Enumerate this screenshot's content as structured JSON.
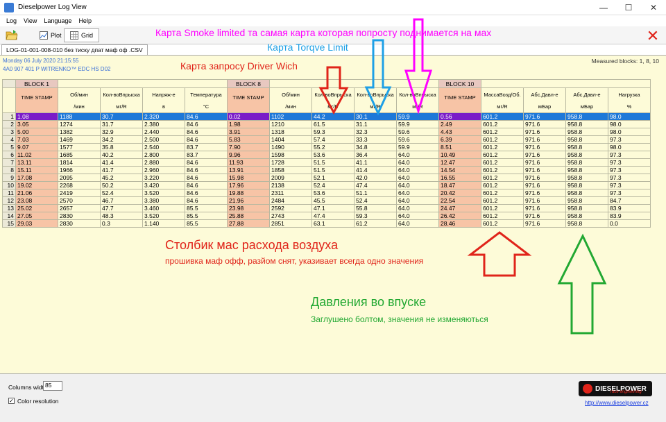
{
  "window": {
    "title": "Dieselpower Log View",
    "minimize": "—",
    "maximize": "☐",
    "close": "✕"
  },
  "menu": [
    "Log",
    "View",
    "Language",
    "Help"
  ],
  "toolbar": {
    "plot_label": "Plot",
    "grid_label": "Grid",
    "close_glyph": "✕"
  },
  "file_tab": "LOG-01-001-008-010  без тиску дпат маф оф .CSV",
  "info": {
    "line1": "Monday 06 July 2020 21:15:55",
    "line2": "4A0 907 401 P  WITRENKO™   EDC  HS D02",
    "measured": "Measured blocks: 1, 8, 10"
  },
  "annotations": {
    "smoke": "Карта Smoke limited та самая карта которая попросту поднимается на мах",
    "torque": "Карта Torqve Limit",
    "driver": "Карта запросу Driver Wich",
    "maf_title": "Столбик мас расхода воздуха",
    "maf_sub": "прошивка маф офф, разйом снят, указивает всегда одно значения",
    "boost_title": "Давления во впуске",
    "boost_sub": "Заглушено болтом, значения не изменяються"
  },
  "colors": {
    "smoke": "#ff00ff",
    "torque": "#1ea0e6",
    "driver": "#e0241a",
    "boost": "#22a832"
  },
  "grid": {
    "blocks": [
      "BLOCK 1",
      "BLOCK 8",
      "BLOCK 10"
    ],
    "headers": [
      {
        "name": "TIME STAMP",
        "unit": ""
      },
      {
        "name": "Об/мин",
        "unit": "/мин"
      },
      {
        "name": "Кол-воВпрыска",
        "unit": "мг/R"
      },
      {
        "name": "Напряж-е",
        "unit": "в"
      },
      {
        "name": "Температура",
        "unit": "°C"
      },
      {
        "name": "TIME STAMP",
        "unit": ""
      },
      {
        "name": "Об/мин",
        "unit": "/мин"
      },
      {
        "name": "Кол-воВпрыска",
        "unit": "мг/R"
      },
      {
        "name": "Кол-воВпрыска",
        "unit": "мг/R"
      },
      {
        "name": "Кол-воВпрыска",
        "unit": "мг/R"
      },
      {
        "name": "TIME STAMP",
        "unit": ""
      },
      {
        "name": "МассаВозд/Об.",
        "unit": "мг/R"
      },
      {
        "name": "Абс.Давл-е",
        "unit": "мБар"
      },
      {
        "name": "Абс.Давл-е",
        "unit": "мБар"
      },
      {
        "name": "Нагрузка",
        "unit": "%"
      }
    ],
    "rows": [
      [
        "1.08",
        "1188",
        "30.7",
        "2.320",
        "84.6",
        "0.02",
        "1102",
        "44.2",
        "30.1",
        "59.9",
        "0.56",
        "601.2",
        "971.6",
        "958.8",
        "98.0"
      ],
      [
        "3.05",
        "1274",
        "31.7",
        "2.380",
        "84.6",
        "1.98",
        "1210",
        "61.5",
        "31.1",
        "59.9",
        "2.49",
        "601.2",
        "971.6",
        "958.8",
        "98.0"
      ],
      [
        "5.00",
        "1382",
        "32.9",
        "2.440",
        "84.6",
        "3.91",
        "1318",
        "59.3",
        "32.3",
        "59.6",
        "4.43",
        "601.2",
        "971.6",
        "958.8",
        "98.0"
      ],
      [
        "7.03",
        "1469",
        "34.2",
        "2.500",
        "84.6",
        "5.83",
        "1404",
        "57.4",
        "33.3",
        "59.6",
        "6.39",
        "601.2",
        "971.6",
        "958.8",
        "97.3"
      ],
      [
        "9.07",
        "1577",
        "35.8",
        "2.540",
        "83.7",
        "7.90",
        "1490",
        "55.2",
        "34.8",
        "59.9",
        "8.51",
        "601.2",
        "971.6",
        "958.8",
        "98.0"
      ],
      [
        "11.02",
        "1685",
        "40.2",
        "2.800",
        "83.7",
        "9.96",
        "1598",
        "53.6",
        "36.4",
        "64.0",
        "10.49",
        "601.2",
        "971.6",
        "958.8",
        "97.3"
      ],
      [
        "13.11",
        "1814",
        "41.4",
        "2.880",
        "84.6",
        "11.93",
        "1728",
        "51.5",
        "41.1",
        "64.0",
        "12.47",
        "601.2",
        "971.6",
        "958.8",
        "97.3"
      ],
      [
        "15.11",
        "1966",
        "41.7",
        "2.960",
        "84.6",
        "13.91",
        "1858",
        "51.5",
        "41.4",
        "64.0",
        "14.54",
        "601.2",
        "971.6",
        "958.8",
        "97.3"
      ],
      [
        "17.08",
        "2095",
        "45.2",
        "3.220",
        "84.6",
        "15.98",
        "2009",
        "52.1",
        "42.0",
        "64.0",
        "16.55",
        "601.2",
        "971.6",
        "958.8",
        "97.3"
      ],
      [
        "19.02",
        "2268",
        "50.2",
        "3.420",
        "84.6",
        "17.96",
        "2138",
        "52.4",
        "47.4",
        "64.0",
        "18.47",
        "601.2",
        "971.6",
        "958.8",
        "97.3"
      ],
      [
        "21.06",
        "2419",
        "52.4",
        "3.520",
        "84.6",
        "19.88",
        "2311",
        "53.6",
        "51.1",
        "64.0",
        "20.42",
        "601.2",
        "971.6",
        "958.8",
        "97.3"
      ],
      [
        "23.08",
        "2570",
        "46.7",
        "3.380",
        "84.6",
        "21.96",
        "2484",
        "45.5",
        "52.4",
        "64.0",
        "22.54",
        "601.2",
        "971.6",
        "958.8",
        "84.7"
      ],
      [
        "25.02",
        "2657",
        "47.7",
        "3.460",
        "85.5",
        "23.98",
        "2592",
        "47.1",
        "55.8",
        "64.0",
        "24.47",
        "601.2",
        "971.6",
        "958.8",
        "83.9"
      ],
      [
        "27.05",
        "2830",
        "48.3",
        "3.520",
        "85.5",
        "25.88",
        "2743",
        "47.4",
        "59.3",
        "64.0",
        "26.42",
        "601.2",
        "971.6",
        "958.8",
        "83.9"
      ],
      [
        "29.03",
        "2830",
        "0.3",
        "1.140",
        "85.5",
        "27.88",
        "2851",
        "63.1",
        "61.2",
        "64.0",
        "28.46",
        "601.2",
        "971.6",
        "958.8",
        "0.0"
      ]
    ]
  },
  "bottom": {
    "columns_width_label": "Columns width:",
    "columns_width_value": "85",
    "color_resolution_label": "Color resolution",
    "color_resolution_check": "✓",
    "logo_text": "DIESELPOWER",
    "logo_sub": "race engineering",
    "link": "http://www.dieselpower.cz"
  }
}
